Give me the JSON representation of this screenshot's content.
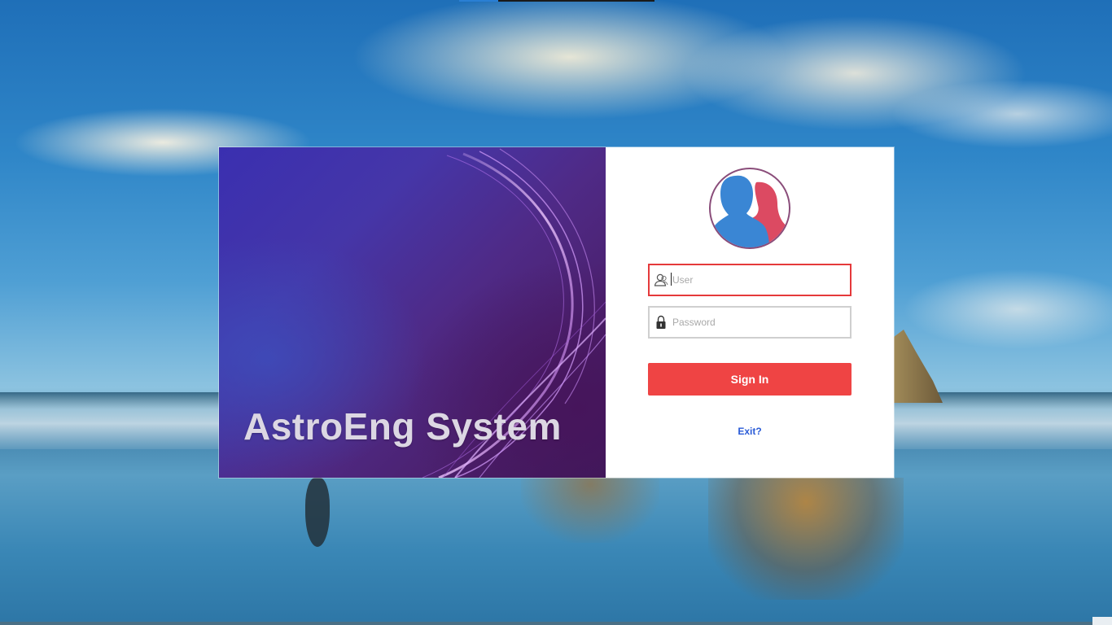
{
  "window": {
    "app_title": "AstroEng System"
  },
  "login": {
    "avatar_icon": "users-icon",
    "user_field": {
      "placeholder": "User",
      "value": "",
      "icon": "user-icon",
      "focused": true
    },
    "password_field": {
      "placeholder": "Password",
      "value": "",
      "icon": "lock-icon"
    },
    "sign_in_label": "Sign In",
    "exit_label": "Exit?"
  },
  "colors": {
    "accent": "#ef4444",
    "focus_border": "#e5393b",
    "link": "#2a5bd7",
    "brand_panel": "#4a2a8a"
  }
}
